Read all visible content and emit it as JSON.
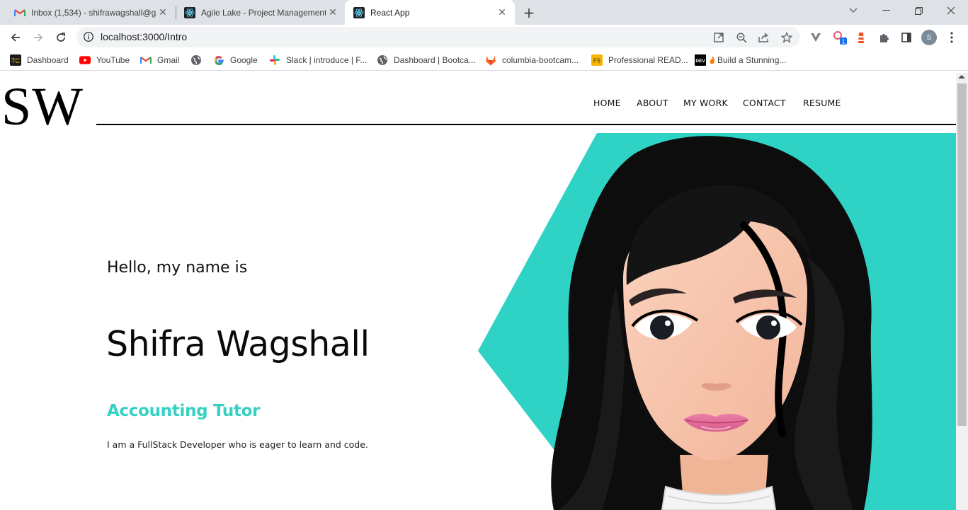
{
  "browser": {
    "tabs": [
      {
        "title": "Inbox (1,534) - shifrawagshall@g",
        "icon": "gmail-icon",
        "active": false
      },
      {
        "title": "Agile Lake - Project Management",
        "icon": "react-icon",
        "active": false
      },
      {
        "title": "React App",
        "icon": "react-icon",
        "active": true
      }
    ],
    "url": "localhost:3000/Intro",
    "profile_initial": "S",
    "extension_badge": "1",
    "bookmarks": [
      {
        "label": "Dashboard",
        "icon": "tc-icon"
      },
      {
        "label": "YouTube",
        "icon": "youtube-icon"
      },
      {
        "label": "Gmail",
        "icon": "gmail-icon"
      },
      {
        "label": "",
        "icon": "globe-icon"
      },
      {
        "label": "Google",
        "icon": "google-icon"
      },
      {
        "label": "Slack | introduce | F...",
        "icon": "slack-icon"
      },
      {
        "label": "Dashboard | Bootca...",
        "icon": "globe-icon"
      },
      {
        "label": "columbia-bootcam...",
        "icon": "gitlab-icon"
      },
      {
        "label": "Professional READ...",
        "icon": "fs-icon"
      },
      {
        "label": "Build a Stunning...",
        "icon": "dev-icon"
      }
    ]
  },
  "site": {
    "logo": "SW",
    "nav": [
      "HOME",
      "ABOUT",
      "MY WORK",
      "CONTACT",
      "RESUME"
    ],
    "hero": {
      "greeting": "Hello, my name is",
      "name": "Shifra Wagshall",
      "role": "Accounting Tutor",
      "description": "I am a FullStack Developer who is eager to learn and code."
    },
    "colors": {
      "accent": "#2fd3c6",
      "text": "#0a0a0a"
    }
  }
}
